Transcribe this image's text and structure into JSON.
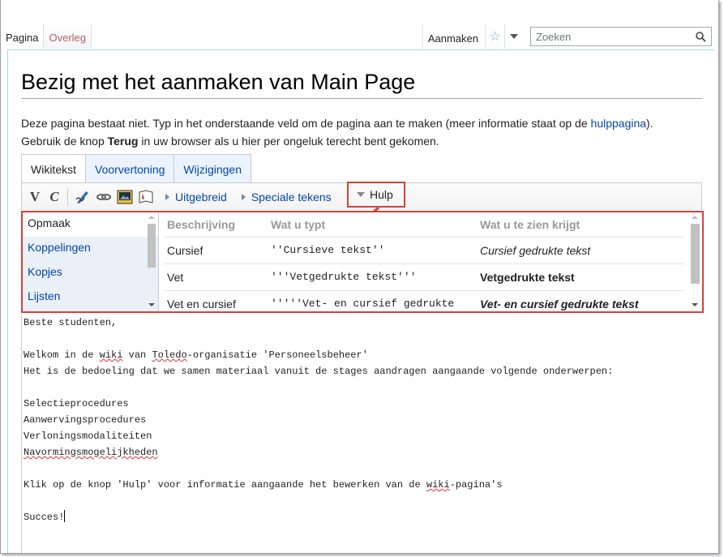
{
  "colors": {
    "accent_red": "#d9403a",
    "link_blue": "#0645ad"
  },
  "top_tabs": {
    "pagina": "Pagina",
    "overleg": "Overleg",
    "aanmaken": "Aanmaken",
    "search_placeholder": "Zoeken"
  },
  "page": {
    "title": "Bezig met het aanmaken van Main Page",
    "intro_1": "Deze pagina bestaat niet. Typ in het onderstaande veld om de pagina aan te maken (meer informatie staat op de ",
    "intro_link": "hulppagina",
    "intro_2": ").",
    "intro_3": "Gebruik de knop ",
    "intro_bold": "Terug",
    "intro_4": " in uw browser als u hier per ongeluk terecht bent gekomen."
  },
  "edit_tabs": [
    "Wikitekst",
    "Voorvertoning",
    "Wijzigingen"
  ],
  "toolbar": {
    "uitgebreid": "Uitgebreid",
    "speciale_tekens": "Speciale tekens",
    "hulp": "Hulp"
  },
  "help": {
    "sections": [
      "Opmaak",
      "Koppelingen",
      "Kopjes",
      "Lijsten"
    ],
    "headers": [
      "Beschrijving",
      "Wat u typt",
      "Wat u te zien krijgt"
    ],
    "rows": [
      {
        "desc": "Cursief",
        "typed": "''Cursieve tekst''",
        "result": "Cursief gedrukte tekst"
      },
      {
        "desc": "Vet",
        "typed": "'''Vetgedrukte tekst'''",
        "result": "Vetgedrukte tekst"
      },
      {
        "desc": "Vet en cursief",
        "typed": "'''''Vet- en cursief gedrukte",
        "result": "Vet- en cursief gedrukte tekst"
      }
    ]
  },
  "editor": {
    "l1": "Beste studenten,",
    "l2a": "Welkom in de ",
    "l2b": "wiki",
    "l2c": " van ",
    "l2d": "Toledo",
    "l2e": "-organisatie 'Personeelsbeheer'",
    "l3": "Het is de bedoeling dat we samen materiaal vanuit de stages aandragen aangaande volgende onderwerpen:",
    "l4": "Selectieprocedures",
    "l5": "Aanwervingsprocedures",
    "l6": "Verloningsmodaliteiten",
    "l7": "Navormingsmogelijkheden",
    "l8a": "Klik op de knop 'Hulp' voor informatie aangaande het bewerken van de ",
    "l8b": "wiki",
    "l8c": "-pagina's",
    "l9": "Succes!"
  }
}
